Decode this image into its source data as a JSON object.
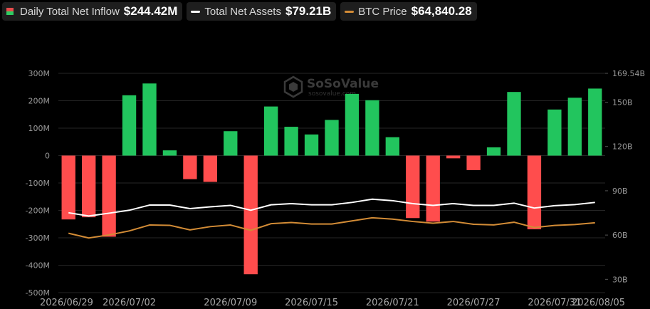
{
  "legend": {
    "inflow": {
      "label": "Daily Total Net Inflow",
      "value": "$244.42M"
    },
    "assets": {
      "label": "Total Net Assets",
      "value": "$79.21B",
      "color": "#ffffff"
    },
    "btc": {
      "label": "BTC Price",
      "value": "$64,840.28",
      "color": "#d38c36"
    }
  },
  "watermark": {
    "name": "SoSoValue",
    "domain": "sosovalue.com"
  },
  "colors": {
    "positive": "#22c55e",
    "negative": "#ff4d4d",
    "assets_line": "#ffffff",
    "btc_line": "#d38c36"
  },
  "chart_data": {
    "type": "bar",
    "left_axis": {
      "ticks": [
        300,
        200,
        100,
        0,
        -100,
        -200,
        -300,
        -400,
        -500
      ],
      "tick_labels": [
        "300M",
        "200M",
        "100M",
        "0",
        "-100M",
        "-200M",
        "-300M",
        "-400M",
        "-500M"
      ],
      "range": [
        -500,
        300
      ]
    },
    "right_axis": {
      "ticks": [
        169.54,
        150,
        120,
        90,
        60,
        30
      ],
      "tick_labels": [
        "169.54B",
        "150B",
        "120B",
        "90B",
        "60B",
        "30B"
      ],
      "range": [
        21,
        169.54
      ]
    },
    "x_tick_labels": [
      "2026/06/29",
      "2026/07/02",
      "2026/07/09",
      "2026/07/15",
      "2026/07/21",
      "2026/07/27",
      "2026/07/31",
      "2026/08/05"
    ],
    "x_tick_index": [
      0,
      3,
      8,
      12,
      16,
      20,
      24,
      27
    ],
    "series": [
      {
        "name": "Daily Total Net Inflow",
        "kind": "bar",
        "values": [
          -233,
          -225,
          -296,
          220,
          263,
          19,
          -86,
          -96,
          89,
          -433,
          179,
          105,
          77,
          130,
          225,
          202,
          67,
          -228,
          -241,
          -10,
          -53,
          30,
          232,
          -269,
          168,
          211,
          244.42
        ]
      },
      {
        "name": "Total Net Assets",
        "kind": "line",
        "values": [
          75.1,
          72.9,
          74.8,
          76.8,
          80.3,
          80.3,
          77.9,
          79.1,
          80.1,
          76.8,
          80.5,
          81.3,
          80.5,
          80.5,
          82.1,
          84.3,
          83.3,
          81.3,
          80.1,
          81.3,
          80.1,
          80.1,
          81.6,
          78.3,
          79.9,
          80.6,
          82.1
        ]
      },
      {
        "name": "BTC Price",
        "kind": "line",
        "values": [
          61.2,
          58.0,
          60.1,
          62.8,
          66.8,
          66.6,
          63.5,
          65.7,
          66.8,
          63.2,
          67.7,
          68.5,
          67.5,
          67.5,
          69.6,
          71.7,
          70.8,
          69.2,
          68.0,
          69.2,
          67.3,
          66.9,
          68.7,
          65.1,
          66.5,
          67.1,
          68.3
        ]
      }
    ],
    "grid": true,
    "legend_position": "top-left"
  }
}
